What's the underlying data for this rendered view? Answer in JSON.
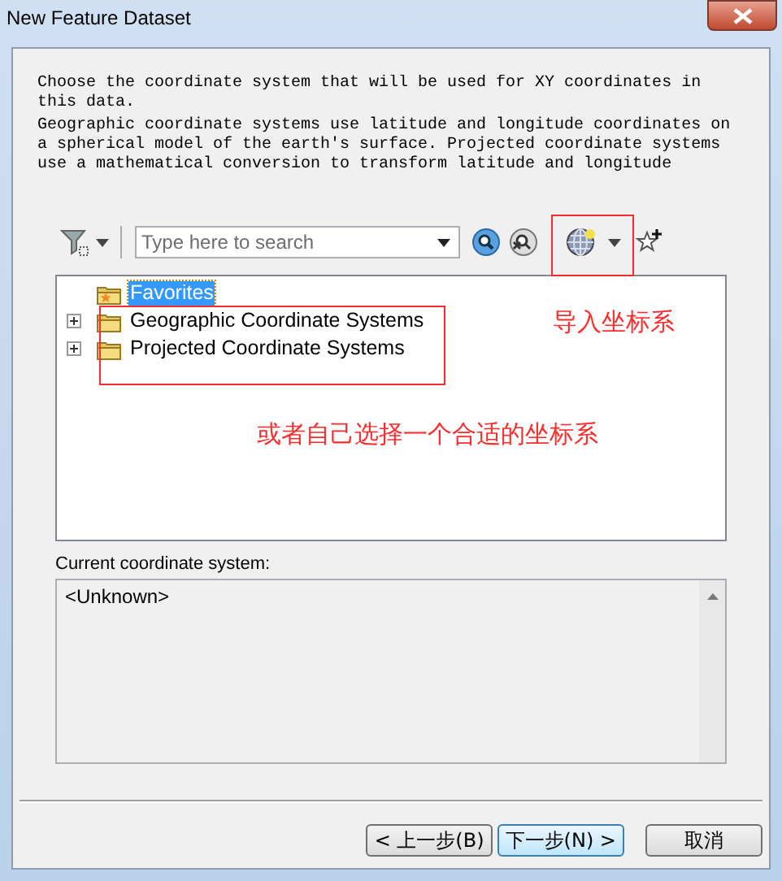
{
  "window": {
    "title": "New Feature Dataset"
  },
  "description": [
    "Choose the coordinate system that will be used for XY coordinates in this data.",
    "Geographic coordinate systems use latitude and longitude coordinates on a spherical model of the earth's surface. Projected coordinate systems use a mathematical conversion to transform latitude and longitude"
  ],
  "search": {
    "placeholder": "Type here to search"
  },
  "tree": [
    {
      "label": "Favorites",
      "kind": "favorites",
      "selected": true,
      "expandable": false
    },
    {
      "label": "Geographic Coordinate Systems",
      "kind": "folder",
      "selected": false,
      "expandable": true
    },
    {
      "label": "Projected Coordinate Systems",
      "kind": "folder",
      "selected": false,
      "expandable": true
    }
  ],
  "current_system": {
    "label": "Current coordinate system:",
    "value": "<Unknown>"
  },
  "buttons": [
    {
      "label": "< 上一步(B)",
      "default": false
    },
    {
      "label": "下一步(N) >",
      "default": true
    },
    {
      "label": "取消",
      "default": false
    }
  ],
  "annotations": [
    {
      "text": "导入坐标系",
      "kind": "import"
    },
    {
      "text": "或者自己选择一个合适的坐标系",
      "kind": "choose"
    }
  ]
}
